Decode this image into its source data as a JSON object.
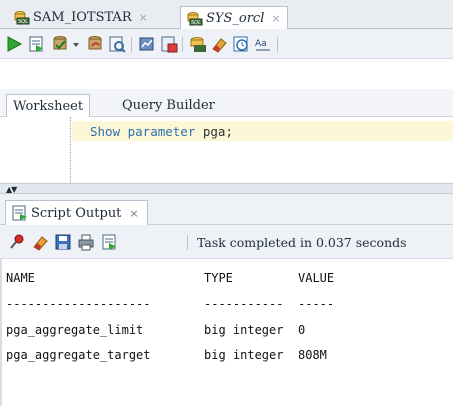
{
  "doc_tabs": [
    {
      "label": "SAM_IOTSTAR"
    },
    {
      "label": "SYS_orcl"
    }
  ],
  "doc_tab_close": "×",
  "worksheet_tabs": [
    {
      "label": "Worksheet"
    },
    {
      "label": "Query Builder"
    }
  ],
  "editor": {
    "keyword": "Show parameter",
    "rest": " pga;"
  },
  "output_tab": {
    "label": "Script Output",
    "close": "×"
  },
  "status": "Task completed in 0.037 seconds",
  "output": {
    "headers": {
      "name": "NAME",
      "type": "TYPE",
      "value": "VALUE"
    },
    "separators": {
      "name": "--------------------",
      "type": "-----------",
      "value": "-----"
    },
    "rows": [
      {
        "name": "pga_aggregate_limit",
        "type": "big integer",
        "value": "0"
      },
      {
        "name": "pga_aggregate_target",
        "type": "big integer",
        "value": "808M"
      }
    ]
  },
  "splitter_arrows": "▲▼"
}
